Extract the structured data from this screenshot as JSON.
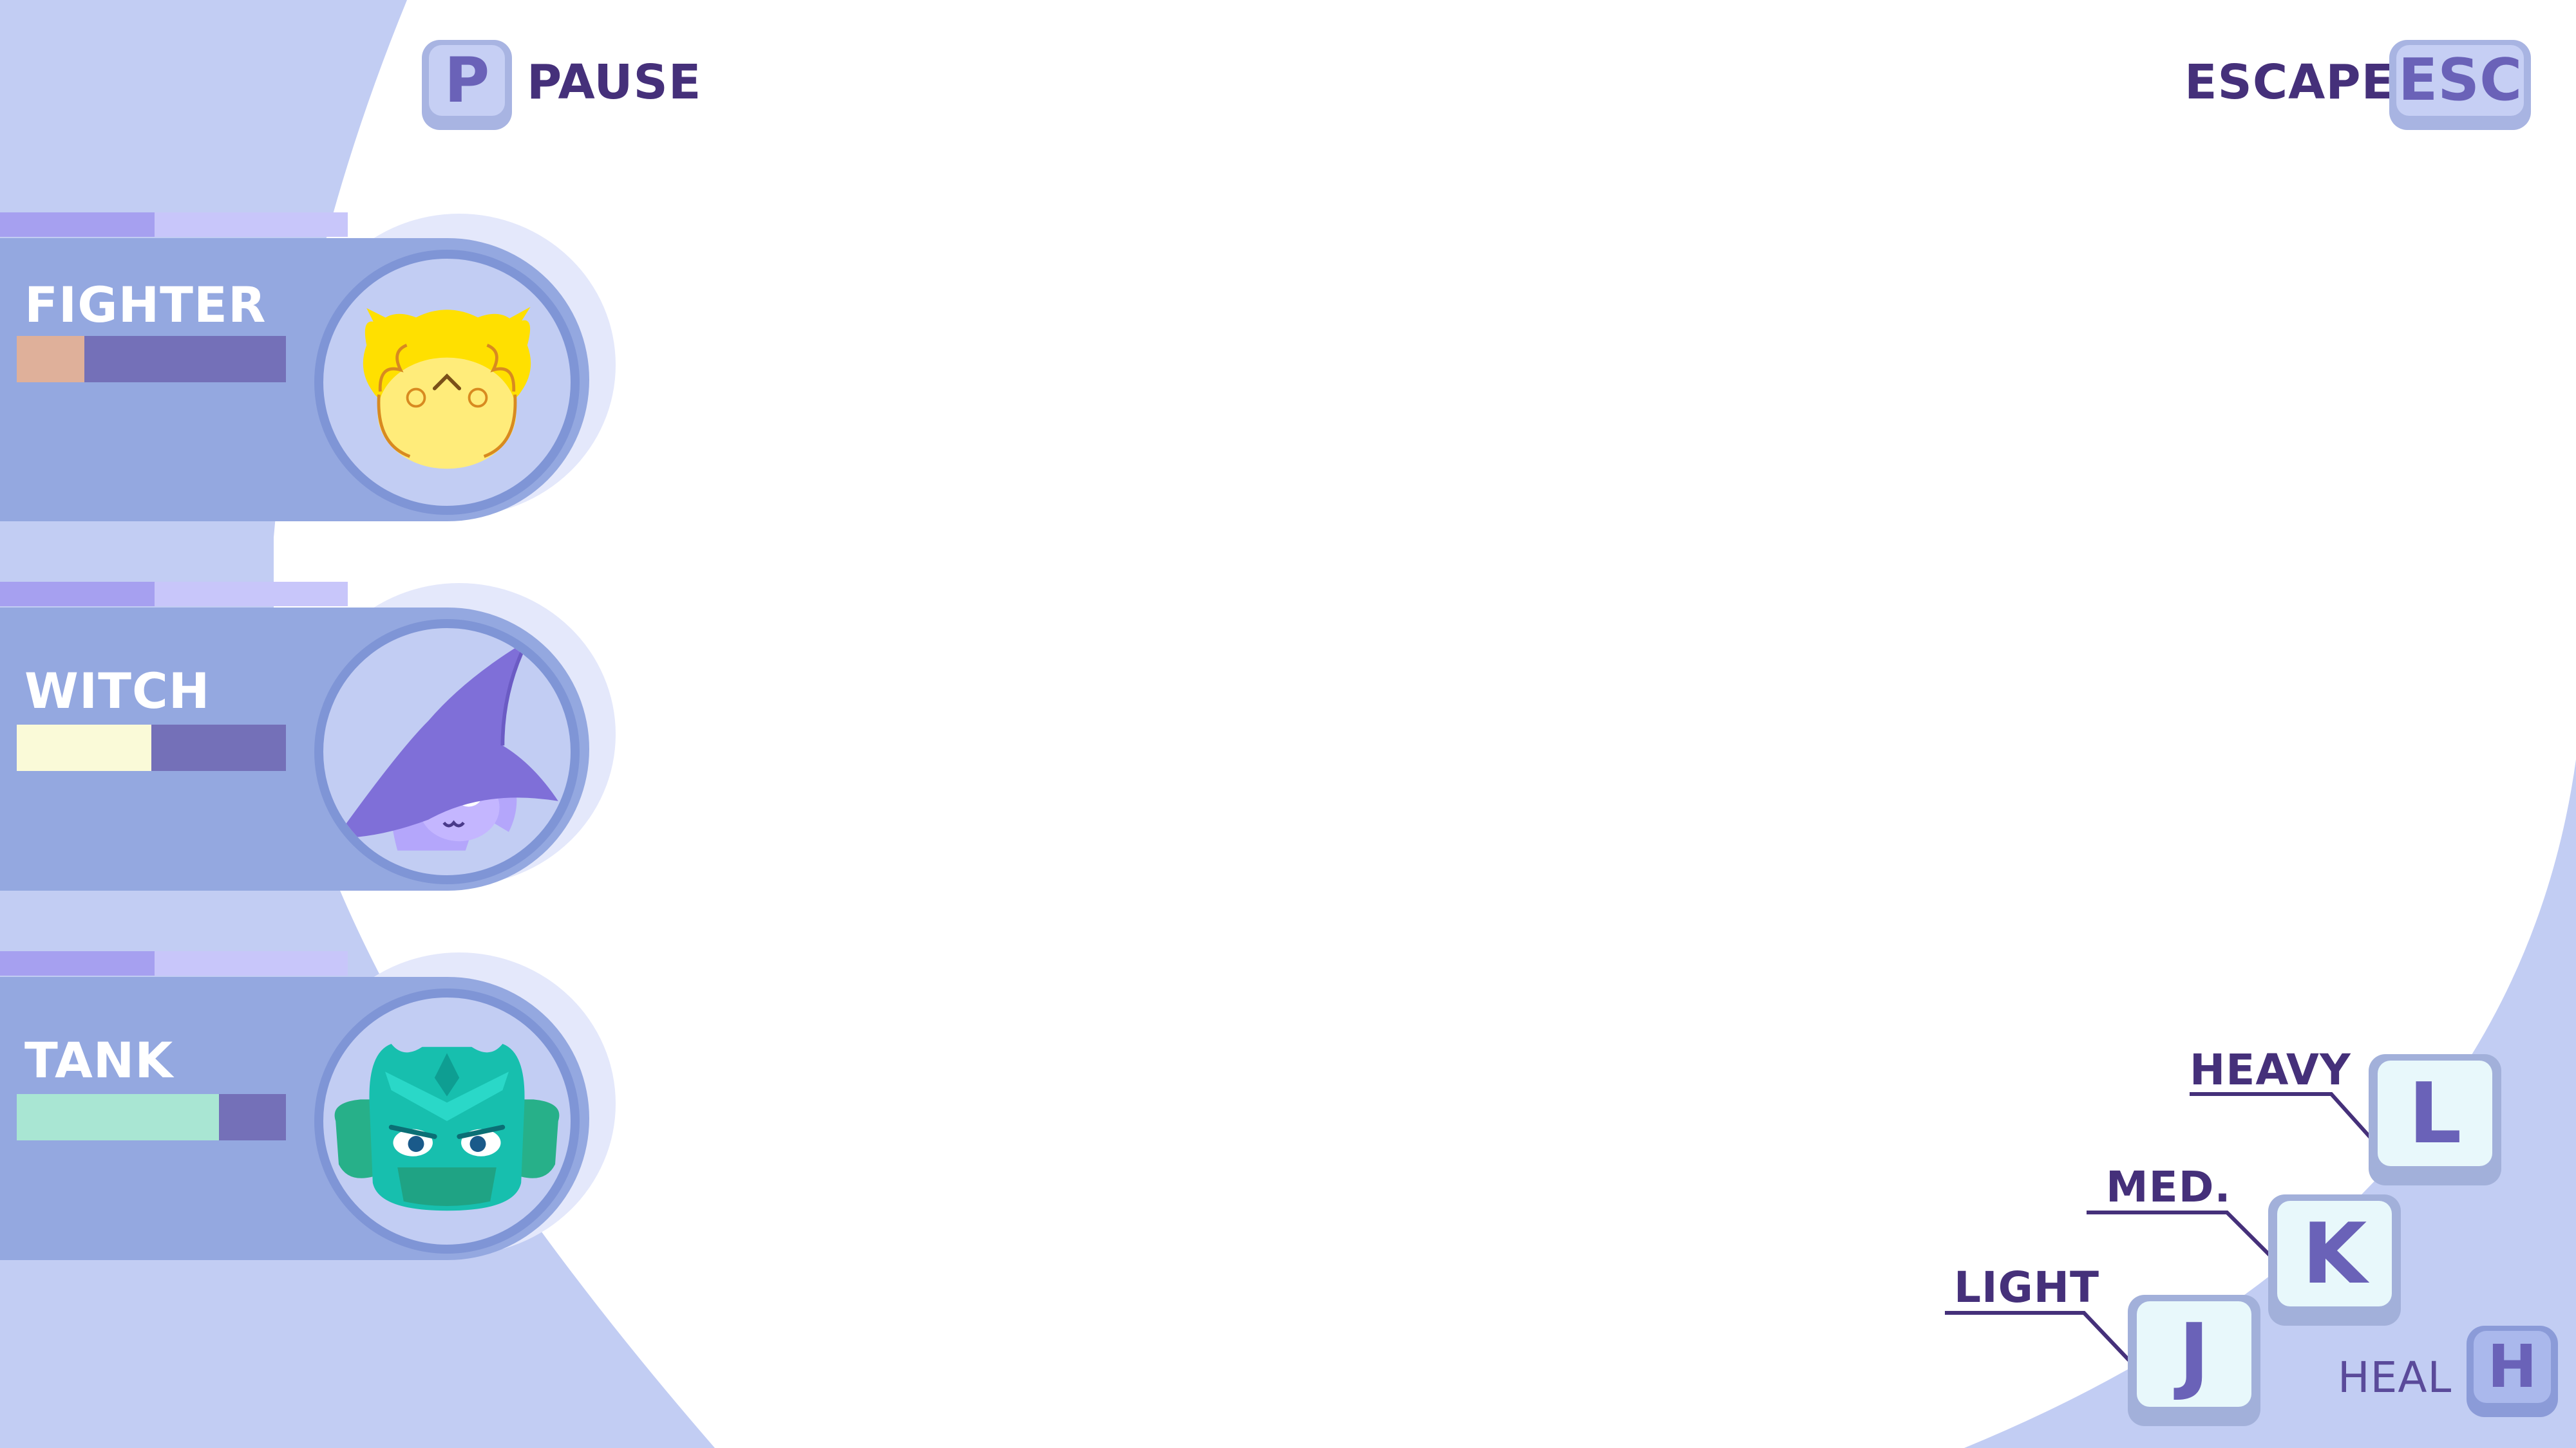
{
  "hud": {
    "pause": {
      "key": "P",
      "label": "PAUSE"
    },
    "escape": {
      "key": "ESC",
      "label": "ESCAPE"
    }
  },
  "characters": [
    {
      "name": "FIGHTER",
      "health": 0.25,
      "bar_color": "#dfb09a",
      "icon": "fighter-portrait-icon"
    },
    {
      "name": "WITCH",
      "health": 0.5,
      "bar_color": "#fafad8",
      "icon": "witch-portrait-icon"
    },
    {
      "name": "TANK",
      "health": 0.75,
      "bar_color": "#a9e6d3",
      "icon": "tank-portrait-icon"
    }
  ],
  "controls": {
    "heavy": {
      "key": "L",
      "label": "HEAVY"
    },
    "medium": {
      "key": "K",
      "label": "MED."
    },
    "light": {
      "key": "J",
      "label": "LIGHT"
    },
    "heal": {
      "key": "H",
      "label": "HEAL"
    }
  },
  "colors": {
    "accent": "#45307a",
    "panel": "#94a8e0",
    "background_shape": "#c2cdf3"
  }
}
